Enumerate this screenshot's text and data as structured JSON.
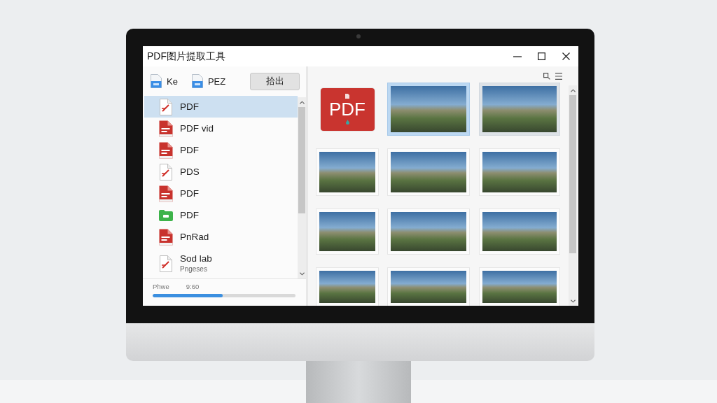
{
  "window": {
    "title": "PDF图片提取工具"
  },
  "toolbar": {
    "items": [
      {
        "label": "Ke"
      },
      {
        "label": "PEZ"
      }
    ],
    "extract_button": "拾出"
  },
  "file_list": {
    "items": [
      {
        "kind": "document",
        "label": "PDF",
        "selected": true
      },
      {
        "kind": "pdf",
        "label": "PDF vid",
        "selected": false
      },
      {
        "kind": "pdf",
        "label": "PDF",
        "selected": false
      },
      {
        "kind": "document",
        "label": "PDS",
        "selected": false
      },
      {
        "kind": "pdf",
        "label": "PDF",
        "selected": false
      },
      {
        "kind": "folder",
        "label": "PDF",
        "selected": false
      },
      {
        "kind": "pdf",
        "label": "PnRad",
        "selected": false
      },
      {
        "kind": "document",
        "label": "Sod lab",
        "subtitle": "Pngeses",
        "selected": false
      }
    ]
  },
  "progress": {
    "label": "Phwe",
    "time": "9:60",
    "level": 0.49
  },
  "thumbnails": {
    "items": [
      {
        "kind": "pdf",
        "label": "PDF",
        "selected": false,
        "hovered": false
      },
      {
        "kind": "photo",
        "selected": true,
        "hovered": false
      },
      {
        "kind": "photo",
        "selected": false,
        "hovered": true
      },
      {
        "kind": "photo",
        "selected": false,
        "hovered": false
      },
      {
        "kind": "photo",
        "selected": false,
        "hovered": false
      },
      {
        "kind": "photo",
        "selected": false,
        "hovered": false
      },
      {
        "kind": "photo",
        "selected": false,
        "hovered": false
      },
      {
        "kind": "photo",
        "selected": false,
        "hovered": false
      },
      {
        "kind": "photo",
        "selected": false,
        "hovered": false
      },
      {
        "kind": "photo",
        "selected": false,
        "hovered": false
      },
      {
        "kind": "photo",
        "selected": false,
        "hovered": false
      },
      {
        "kind": "photo",
        "selected": false,
        "hovered": false
      }
    ]
  }
}
